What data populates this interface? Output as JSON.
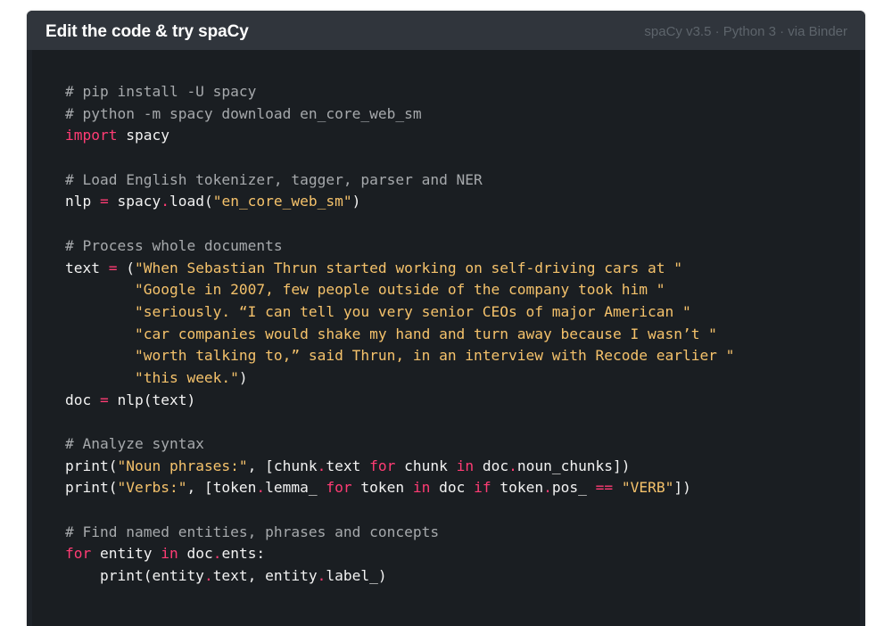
{
  "widget": {
    "title": "Edit the code & try spaCy",
    "meta": "spaCy v3.5 · Python 3 · via Binder"
  },
  "colors": {
    "header_bg": "#30353c",
    "editor_bg": "#1a1e22",
    "keyword": "#ff3c74",
    "string": "#f5c26b",
    "comment": "#a6a9ac",
    "text": "#f2f2f2"
  },
  "code_lines": [
    [
      {
        "t": "comment",
        "v": "# pip install -U spacy"
      }
    ],
    [
      {
        "t": "comment",
        "v": "# python -m spacy download en_core_web_sm"
      }
    ],
    [
      {
        "t": "kw",
        "v": "import"
      },
      {
        "t": "plain",
        "v": " spacy"
      }
    ],
    [],
    [
      {
        "t": "comment",
        "v": "# Load English tokenizer, tagger, parser and NER"
      }
    ],
    [
      {
        "t": "plain",
        "v": "nlp "
      },
      {
        "t": "op",
        "v": "="
      },
      {
        "t": "plain",
        "v": " spacy"
      },
      {
        "t": "op",
        "v": "."
      },
      {
        "t": "plain",
        "v": "load("
      },
      {
        "t": "str",
        "v": "\"en_core_web_sm\""
      },
      {
        "t": "plain",
        "v": ")"
      }
    ],
    [],
    [
      {
        "t": "comment",
        "v": "# Process whole documents"
      }
    ],
    [
      {
        "t": "plain",
        "v": "text "
      },
      {
        "t": "op",
        "v": "="
      },
      {
        "t": "plain",
        "v": " ("
      },
      {
        "t": "str",
        "v": "\"When Sebastian Thrun started working on self-driving cars at \""
      }
    ],
    [
      {
        "t": "plain",
        "v": "        "
      },
      {
        "t": "str",
        "v": "\"Google in 2007, few people outside of the company took him \""
      }
    ],
    [
      {
        "t": "plain",
        "v": "        "
      },
      {
        "t": "str",
        "v": "\"seriously. “I can tell you very senior CEOs of major American \""
      }
    ],
    [
      {
        "t": "plain",
        "v": "        "
      },
      {
        "t": "str",
        "v": "\"car companies would shake my hand and turn away because I wasn’t \""
      }
    ],
    [
      {
        "t": "plain",
        "v": "        "
      },
      {
        "t": "str",
        "v": "\"worth talking to,” said Thrun, in an interview with Recode earlier \""
      }
    ],
    [
      {
        "t": "plain",
        "v": "        "
      },
      {
        "t": "str",
        "v": "\"this week.\""
      },
      {
        "t": "plain",
        "v": ")"
      }
    ],
    [
      {
        "t": "plain",
        "v": "doc "
      },
      {
        "t": "op",
        "v": "="
      },
      {
        "t": "plain",
        "v": " nlp(text)"
      }
    ],
    [],
    [
      {
        "t": "comment",
        "v": "# Analyze syntax"
      }
    ],
    [
      {
        "t": "plain",
        "v": "print("
      },
      {
        "t": "str",
        "v": "\"Noun phrases:\""
      },
      {
        "t": "plain",
        "v": ", [chunk"
      },
      {
        "t": "op",
        "v": "."
      },
      {
        "t": "plain",
        "v": "text "
      },
      {
        "t": "kw",
        "v": "for"
      },
      {
        "t": "plain",
        "v": " chunk "
      },
      {
        "t": "kw",
        "v": "in"
      },
      {
        "t": "plain",
        "v": " doc"
      },
      {
        "t": "op",
        "v": "."
      },
      {
        "t": "plain",
        "v": "noun_chunks])"
      }
    ],
    [
      {
        "t": "plain",
        "v": "print("
      },
      {
        "t": "str",
        "v": "\"Verbs:\""
      },
      {
        "t": "plain",
        "v": ", [token"
      },
      {
        "t": "op",
        "v": "."
      },
      {
        "t": "plain",
        "v": "lemma_ "
      },
      {
        "t": "kw",
        "v": "for"
      },
      {
        "t": "plain",
        "v": " token "
      },
      {
        "t": "kw",
        "v": "in"
      },
      {
        "t": "plain",
        "v": " doc "
      },
      {
        "t": "kw",
        "v": "if"
      },
      {
        "t": "plain",
        "v": " token"
      },
      {
        "t": "op",
        "v": "."
      },
      {
        "t": "plain",
        "v": "pos_ "
      },
      {
        "t": "op",
        "v": "=="
      },
      {
        "t": "plain",
        "v": " "
      },
      {
        "t": "str",
        "v": "\"VERB\""
      },
      {
        "t": "plain",
        "v": "])"
      }
    ],
    [],
    [
      {
        "t": "comment",
        "v": "# Find named entities, phrases and concepts"
      }
    ],
    [
      {
        "t": "kw",
        "v": "for"
      },
      {
        "t": "plain",
        "v": " entity "
      },
      {
        "t": "kw",
        "v": "in"
      },
      {
        "t": "plain",
        "v": " doc"
      },
      {
        "t": "op",
        "v": "."
      },
      {
        "t": "plain",
        "v": "ents:"
      }
    ],
    [
      {
        "t": "plain",
        "v": "    print(entity"
      },
      {
        "t": "op",
        "v": "."
      },
      {
        "t": "plain",
        "v": "text, entity"
      },
      {
        "t": "op",
        "v": "."
      },
      {
        "t": "plain",
        "v": "label_)"
      }
    ]
  ]
}
